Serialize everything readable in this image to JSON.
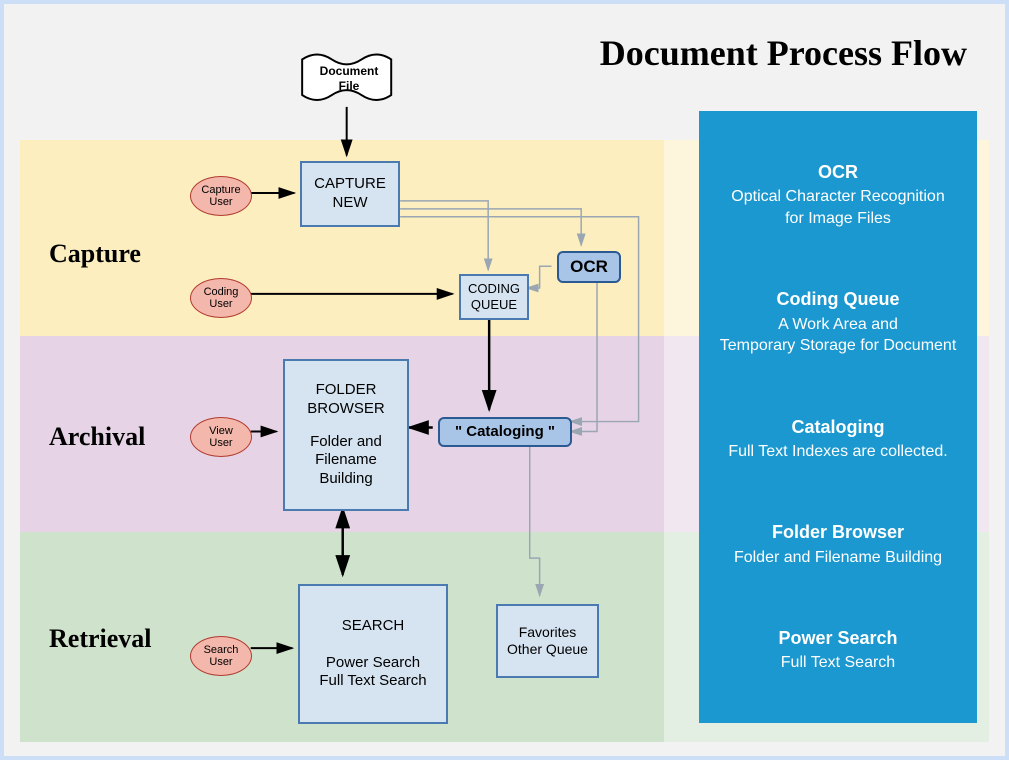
{
  "title": "Document Process Flow",
  "phases": {
    "capture": "Capture",
    "archival": "Archival",
    "retrieval": "Retrieval"
  },
  "nodes": {
    "document_file": "Document\nFile",
    "capture_new": "CAPTURE\nNEW",
    "ocr": "OCR",
    "coding_queue": "CODING\nQUEUE",
    "folder_browser_title": "FOLDER\nBROWSER",
    "folder_browser_sub": "Folder and\nFilename\nBuilding",
    "cataloging": "\" Cataloging \"",
    "search_title": "SEARCH",
    "search_sub": "Power Search\nFull Text Search",
    "favorites": "Favorites\nOther Queue"
  },
  "users": {
    "capture": "Capture\nUser",
    "coding": "Coding\nUser",
    "view": "View\nUser",
    "search": "Search\nUser"
  },
  "info": {
    "ocr": {
      "title": "OCR",
      "desc": "Optical Character Recognition\nfor Image Files"
    },
    "coding": {
      "title": "Coding Queue",
      "desc": "A Work Area and\nTemporary Storage for Document"
    },
    "catalog": {
      "title": "Cataloging",
      "desc": "Full Text Indexes are collected."
    },
    "folder": {
      "title": "Folder Browser",
      "desc": "Folder and Filename Building"
    },
    "search": {
      "title": "Power Search",
      "desc": "Full Text Search"
    }
  }
}
